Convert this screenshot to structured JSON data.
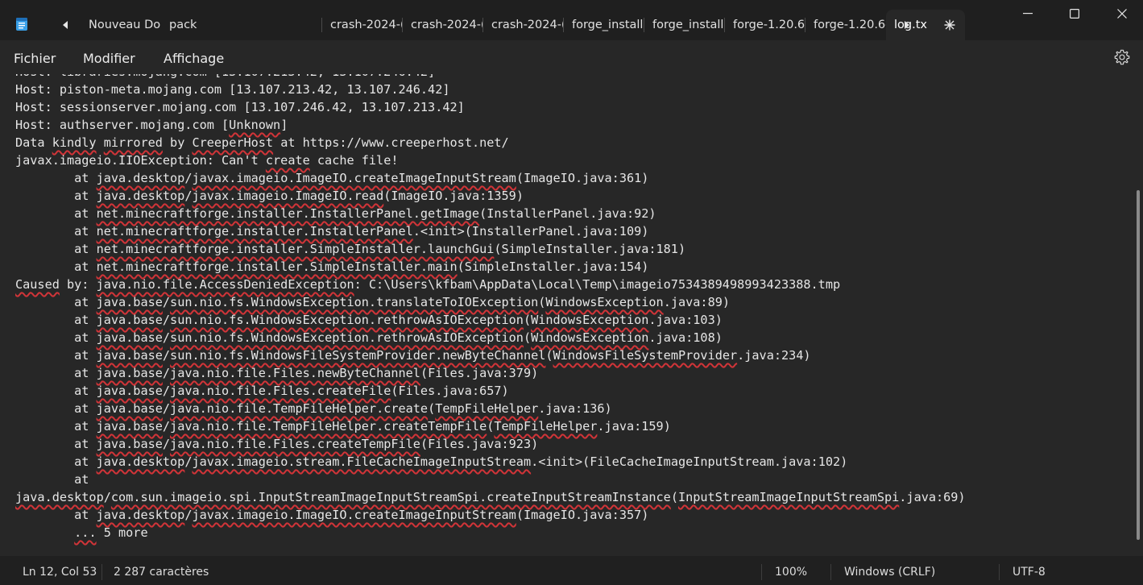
{
  "tabs": [
    {
      "label": "Nouveau Do"
    },
    {
      "label": "pack"
    },
    {
      "label": "crash-2024-("
    },
    {
      "label": "crash-2024-("
    },
    {
      "label": "crash-2024-("
    },
    {
      "label": "forge_install"
    },
    {
      "label": "forge_install"
    },
    {
      "label": "forge-1.20.6-"
    },
    {
      "label": "forge-1.20.6-"
    },
    {
      "label": "log.tx"
    }
  ],
  "menu": {
    "file": "Fichier",
    "edit": "Modifier",
    "view": "Affichage"
  },
  "status": {
    "position": "Ln 12, Col 53",
    "chars": "2 287 caractères",
    "zoom": "100%",
    "line_ending": "Windows (CRLF)",
    "encoding": "UTF-8"
  },
  "lines": [
    "Host: piston-meta.mojang.com [13.107.213.42, 13.107.246.42]",
    "Host: sessionserver.mojang.com [13.107.246.42, 13.107.213.42]",
    "Host: authserver.mojang.com [Unknown]",
    "Data kindly mirrored by CreeperHost at https://www.creeperhost.net/",
    "javax.imageio.IIOException: Can't create cache file!",
    "        at java.desktop/javax.imageio.ImageIO.createImageInputStream(ImageIO.java:361)",
    "        at java.desktop/javax.imageio.ImageIO.read(ImageIO.java:1359)",
    "        at net.minecraftforge.installer.InstallerPanel.getImage(InstallerPanel.java:92)",
    "        at net.minecraftforge.installer.InstallerPanel.<init>(InstallerPanel.java:109)",
    "        at net.minecraftforge.installer.SimpleInstaller.launchGui(SimpleInstaller.java:181)",
    "        at net.minecraftforge.installer.SimpleInstaller.main(SimpleInstaller.java:154)",
    "Caused by: java.nio.file.AccessDeniedException: C:\\Users\\kfbam\\AppData\\Local\\Temp\\imageio7534389498993423388.tmp",
    "        at java.base/sun.nio.fs.WindowsException.translateToIOException(WindowsException.java:89)",
    "        at java.base/sun.nio.fs.WindowsException.rethrowAsIOException(WindowsException.java:103)",
    "        at java.base/sun.nio.fs.WindowsException.rethrowAsIOException(WindowsException.java:108)",
    "        at java.base/sun.nio.fs.WindowsFileSystemProvider.newByteChannel(WindowsFileSystemProvider.java:234)",
    "        at java.base/java.nio.file.Files.newByteChannel(Files.java:379)",
    "        at java.base/java.nio.file.Files.createFile(Files.java:657)",
    "        at java.base/java.nio.file.TempFileHelper.create(TempFileHelper.java:136)",
    "        at java.base/java.nio.file.TempFileHelper.createTempFile(TempFileHelper.java:159)",
    "        at java.base/java.nio.file.Files.createTempFile(Files.java:923)",
    "        at java.desktop/javax.imageio.stream.FileCacheImageInputStream.<init>(FileCacheImageInputStream.java:102)",
    "        at",
    "java.desktop/com.sun.imageio.spi.InputStreamImageInputStreamSpi.createInputStreamInstance(InputStreamImageInputStreamSpi.java:69)",
    "        at java.desktop/javax.imageio.ImageIO.createImageInputStream(ImageIO.java:357)",
    "        ... 5 more"
  ],
  "misspelled": [
    "Unknown",
    "kindly",
    "mirrored",
    "CreeperHost",
    "create",
    "java.desktop",
    "javax.imageio.ImageIO.createImageInputStream",
    "javax.imageio.ImageIO.read",
    "net.minecraftforge.installer.InstallerPanel.getImage",
    "net.minecraftforge.installer.InstallerPanel",
    "net.minecraftforge.installer.SimpleInstaller.launchGui",
    "net.minecraftforge.installer.SimpleInstaller.main",
    "Caused",
    "java.nio.file.AccessDeniedException",
    "java.base",
    "sun.nio.fs.WindowsException.translateToIOException",
    "WindowsException",
    "sun.nio.fs.WindowsException.rethrowAsIOException",
    "sun.nio.fs.WindowsFileSystemProvider.newByteChannel",
    "WindowsFileSystemProvider",
    "java.nio.file.Files.newByteChannel",
    "java.nio.file.Files.createFile",
    "java.nio.file.TempFileHelper.create",
    "java.nio.file.TempFileHelper.createTempFile",
    "TempFileHelper",
    "java.nio.file.Files.createTempFile",
    "javax.imageio.stream.FileCacheImageInputStream",
    "com.sun.imageio.spi.InputStreamImageInputStreamSpi.createInputStreamInstance",
    "InputStreamImageInputStreamSpi",
    "..."
  ]
}
